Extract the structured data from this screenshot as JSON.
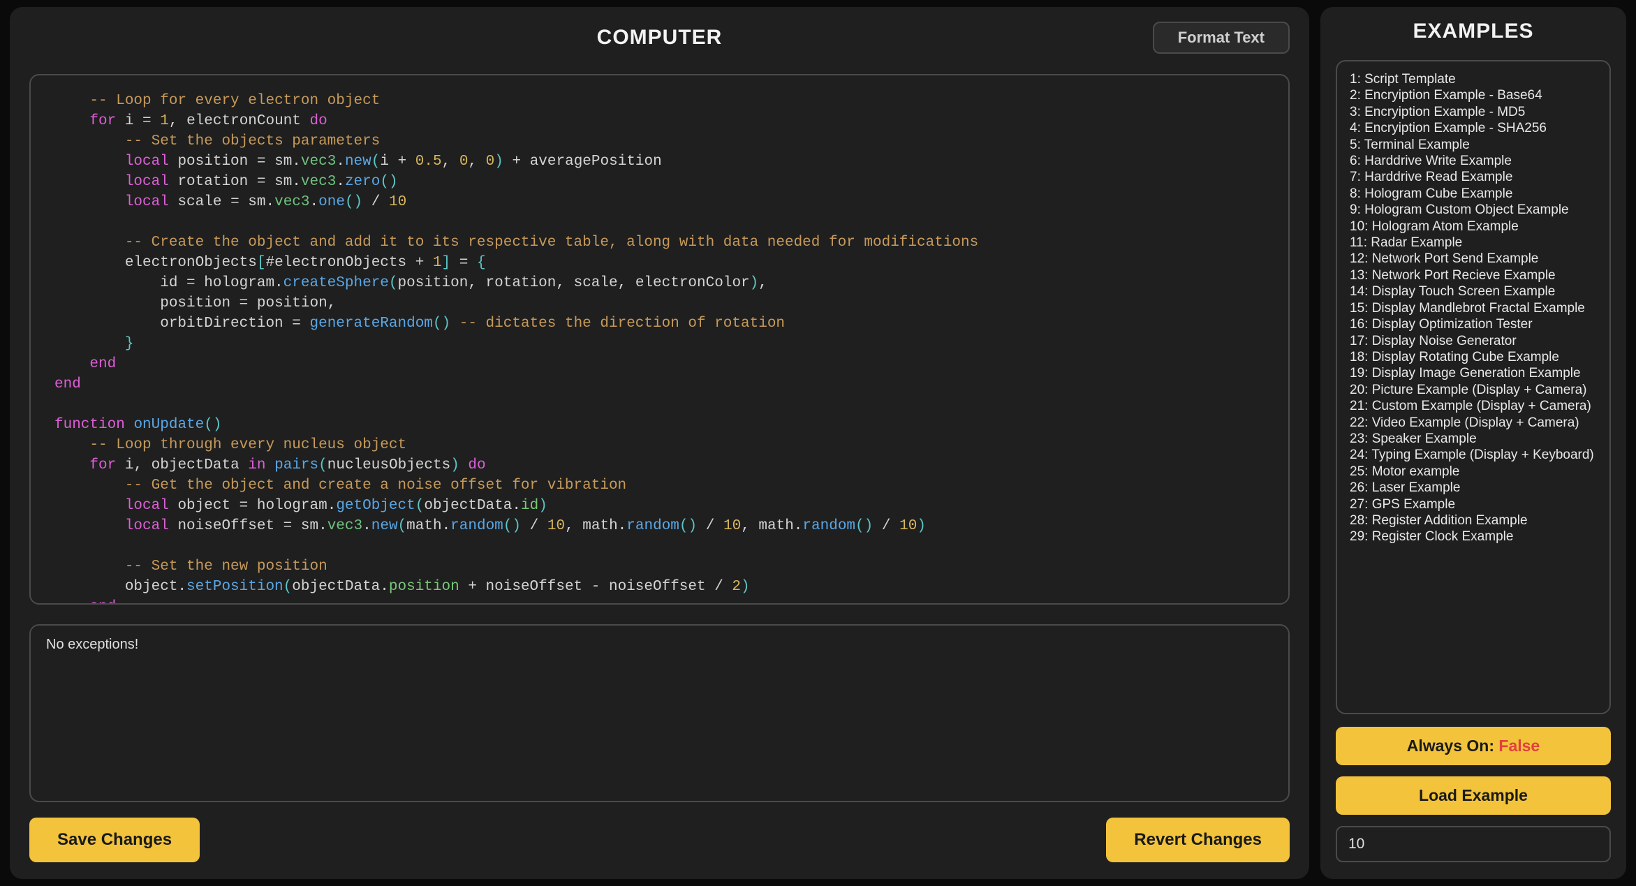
{
  "header": {
    "title": "COMPUTER",
    "format_button": "Format Text"
  },
  "console": {
    "message": "No exceptions!"
  },
  "buttons": {
    "save": "Save Changes",
    "revert": "Revert Changes"
  },
  "side": {
    "title": "EXAMPLES",
    "always_on_label": "Always On: ",
    "always_on_value": "False",
    "load_label": "Load Example",
    "input_value": "10",
    "examples": [
      "1: Script Template",
      "2: Encryiption Example - Base64",
      "3: Encryiption Example - MD5",
      "4: Encryiption Example - SHA256",
      "5: Terminal Example",
      "6: Harddrive Write Example",
      "7: Harddrive Read Example",
      "8: Hologram Cube Example",
      "9: Hologram Custom Object Example",
      "10: Hologram Atom Example",
      "11: Radar Example",
      "12: Network Port Send Example",
      "13: Network Port Recieve Example",
      "14: Display Touch Screen Example",
      "15: Display Mandlebrot Fractal Example",
      "16: Display Optimization Tester",
      "17: Display Noise Generator",
      "18: Display Rotating Cube Example",
      "19: Display Image Generation Example",
      "20: Picture Example (Display + Camera)",
      "21: Custom Example (Display + Camera)",
      "22: Video Example (Display + Camera)",
      "23: Speaker Example",
      "24: Typing Example (Display + Keyboard)",
      "25: Motor example",
      "26: Laser Example",
      "27: GPS Example",
      "28: Register Addition Example",
      "29: Register Clock Example"
    ]
  },
  "code": {
    "tokens": [
      {
        "t": "plain",
        "v": "    "
      },
      {
        "t": "comment",
        "v": "-- Loop for every electron object"
      },
      {
        "t": "nl"
      },
      {
        "t": "plain",
        "v": "    "
      },
      {
        "t": "kw",
        "v": "for"
      },
      {
        "t": "plain",
        "v": " i "
      },
      {
        "t": "op",
        "v": "="
      },
      {
        "t": "plain",
        "v": " "
      },
      {
        "t": "num",
        "v": "1"
      },
      {
        "t": "op",
        "v": ","
      },
      {
        "t": "plain",
        "v": " electronCount "
      },
      {
        "t": "kw",
        "v": "do"
      },
      {
        "t": "nl"
      },
      {
        "t": "plain",
        "v": "        "
      },
      {
        "t": "comment",
        "v": "-- Set the objects parameters"
      },
      {
        "t": "nl"
      },
      {
        "t": "plain",
        "v": "        "
      },
      {
        "t": "kw",
        "v": "local"
      },
      {
        "t": "plain",
        "v": " position "
      },
      {
        "t": "op",
        "v": "="
      },
      {
        "t": "plain",
        "v": " sm."
      },
      {
        "t": "type",
        "v": "vec3"
      },
      {
        "t": "op",
        "v": "."
      },
      {
        "t": "func",
        "v": "new"
      },
      {
        "t": "paren",
        "v": "("
      },
      {
        "t": "plain",
        "v": "i "
      },
      {
        "t": "op",
        "v": "+"
      },
      {
        "t": "plain",
        "v": " "
      },
      {
        "t": "num",
        "v": "0.5"
      },
      {
        "t": "op",
        "v": ","
      },
      {
        "t": "plain",
        "v": " "
      },
      {
        "t": "num",
        "v": "0"
      },
      {
        "t": "op",
        "v": ","
      },
      {
        "t": "plain",
        "v": " "
      },
      {
        "t": "num",
        "v": "0"
      },
      {
        "t": "paren",
        "v": ")"
      },
      {
        "t": "plain",
        "v": " "
      },
      {
        "t": "op",
        "v": "+"
      },
      {
        "t": "plain",
        "v": " averagePosition"
      },
      {
        "t": "nl"
      },
      {
        "t": "plain",
        "v": "        "
      },
      {
        "t": "kw",
        "v": "local"
      },
      {
        "t": "plain",
        "v": " rotation "
      },
      {
        "t": "op",
        "v": "="
      },
      {
        "t": "plain",
        "v": " sm."
      },
      {
        "t": "type",
        "v": "vec3"
      },
      {
        "t": "op",
        "v": "."
      },
      {
        "t": "func",
        "v": "zero"
      },
      {
        "t": "paren",
        "v": "()"
      },
      {
        "t": "nl"
      },
      {
        "t": "plain",
        "v": "        "
      },
      {
        "t": "kw",
        "v": "local"
      },
      {
        "t": "plain",
        "v": " scale "
      },
      {
        "t": "op",
        "v": "="
      },
      {
        "t": "plain",
        "v": " sm."
      },
      {
        "t": "type",
        "v": "vec3"
      },
      {
        "t": "op",
        "v": "."
      },
      {
        "t": "func",
        "v": "one"
      },
      {
        "t": "paren",
        "v": "()"
      },
      {
        "t": "plain",
        "v": " "
      },
      {
        "t": "op",
        "v": "/"
      },
      {
        "t": "plain",
        "v": " "
      },
      {
        "t": "num",
        "v": "10"
      },
      {
        "t": "nl"
      },
      {
        "t": "nl"
      },
      {
        "t": "plain",
        "v": "        "
      },
      {
        "t": "comment",
        "v": "-- Create the object and add it to its respective table, along with data needed for modifications"
      },
      {
        "t": "nl"
      },
      {
        "t": "plain",
        "v": "        electronObjects"
      },
      {
        "t": "paren",
        "v": "["
      },
      {
        "t": "op",
        "v": "#"
      },
      {
        "t": "plain",
        "v": "electronObjects "
      },
      {
        "t": "op",
        "v": "+"
      },
      {
        "t": "plain",
        "v": " "
      },
      {
        "t": "num",
        "v": "1"
      },
      {
        "t": "paren",
        "v": "]"
      },
      {
        "t": "plain",
        "v": " "
      },
      {
        "t": "op",
        "v": "="
      },
      {
        "t": "plain",
        "v": " "
      },
      {
        "t": "paren",
        "v": "{"
      },
      {
        "t": "nl"
      },
      {
        "t": "plain",
        "v": "            id "
      },
      {
        "t": "op",
        "v": "="
      },
      {
        "t": "plain",
        "v": " hologram."
      },
      {
        "t": "func",
        "v": "createSphere"
      },
      {
        "t": "paren",
        "v": "("
      },
      {
        "t": "plain",
        "v": "position"
      },
      {
        "t": "op",
        "v": ","
      },
      {
        "t": "plain",
        "v": " rotation"
      },
      {
        "t": "op",
        "v": ","
      },
      {
        "t": "plain",
        "v": " scale"
      },
      {
        "t": "op",
        "v": ","
      },
      {
        "t": "plain",
        "v": " electronColor"
      },
      {
        "t": "paren",
        "v": ")"
      },
      {
        "t": "op",
        "v": ","
      },
      {
        "t": "nl"
      },
      {
        "t": "plain",
        "v": "            position "
      },
      {
        "t": "op",
        "v": "="
      },
      {
        "t": "plain",
        "v": " position"
      },
      {
        "t": "op",
        "v": ","
      },
      {
        "t": "nl"
      },
      {
        "t": "plain",
        "v": "            orbitDirection "
      },
      {
        "t": "op",
        "v": "="
      },
      {
        "t": "plain",
        "v": " "
      },
      {
        "t": "func",
        "v": "generateRandom"
      },
      {
        "t": "paren",
        "v": "()"
      },
      {
        "t": "plain",
        "v": " "
      },
      {
        "t": "comment",
        "v": "-- dictates the direction of rotation"
      },
      {
        "t": "nl"
      },
      {
        "t": "plain",
        "v": "        "
      },
      {
        "t": "paren",
        "v": "}"
      },
      {
        "t": "nl"
      },
      {
        "t": "plain",
        "v": "    "
      },
      {
        "t": "kw",
        "v": "end"
      },
      {
        "t": "nl"
      },
      {
        "t": "kw",
        "v": "end"
      },
      {
        "t": "nl"
      },
      {
        "t": "nl"
      },
      {
        "t": "kw",
        "v": "function"
      },
      {
        "t": "plain",
        "v": " "
      },
      {
        "t": "func",
        "v": "onUpdate"
      },
      {
        "t": "paren",
        "v": "()"
      },
      {
        "t": "nl"
      },
      {
        "t": "plain",
        "v": "    "
      },
      {
        "t": "comment",
        "v": "-- Loop through every nucleus object"
      },
      {
        "t": "nl"
      },
      {
        "t": "plain",
        "v": "    "
      },
      {
        "t": "kw",
        "v": "for"
      },
      {
        "t": "plain",
        "v": " i"
      },
      {
        "t": "op",
        "v": ","
      },
      {
        "t": "plain",
        "v": " objectData "
      },
      {
        "t": "kw",
        "v": "in"
      },
      {
        "t": "plain",
        "v": " "
      },
      {
        "t": "func",
        "v": "pairs"
      },
      {
        "t": "paren",
        "v": "("
      },
      {
        "t": "plain",
        "v": "nucleusObjects"
      },
      {
        "t": "paren",
        "v": ")"
      },
      {
        "t": "plain",
        "v": " "
      },
      {
        "t": "kw",
        "v": "do"
      },
      {
        "t": "nl"
      },
      {
        "t": "plain",
        "v": "        "
      },
      {
        "t": "comment",
        "v": "-- Get the object and create a noise offset for vibration"
      },
      {
        "t": "nl"
      },
      {
        "t": "plain",
        "v": "        "
      },
      {
        "t": "kw",
        "v": "local"
      },
      {
        "t": "plain",
        "v": " object "
      },
      {
        "t": "op",
        "v": "="
      },
      {
        "t": "plain",
        "v": " hologram."
      },
      {
        "t": "func",
        "v": "getObject"
      },
      {
        "t": "paren",
        "v": "("
      },
      {
        "t": "plain",
        "v": "objectData."
      },
      {
        "t": "field",
        "v": "id"
      },
      {
        "t": "paren",
        "v": ")"
      },
      {
        "t": "nl"
      },
      {
        "t": "plain",
        "v": "        "
      },
      {
        "t": "kw",
        "v": "local"
      },
      {
        "t": "plain",
        "v": " noiseOffset "
      },
      {
        "t": "op",
        "v": "="
      },
      {
        "t": "plain",
        "v": " sm."
      },
      {
        "t": "type",
        "v": "vec3"
      },
      {
        "t": "op",
        "v": "."
      },
      {
        "t": "func",
        "v": "new"
      },
      {
        "t": "paren",
        "v": "("
      },
      {
        "t": "plain",
        "v": "math."
      },
      {
        "t": "func",
        "v": "random"
      },
      {
        "t": "paren",
        "v": "()"
      },
      {
        "t": "plain",
        "v": " "
      },
      {
        "t": "op",
        "v": "/"
      },
      {
        "t": "plain",
        "v": " "
      },
      {
        "t": "num",
        "v": "10"
      },
      {
        "t": "op",
        "v": ","
      },
      {
        "t": "plain",
        "v": " math."
      },
      {
        "t": "func",
        "v": "random"
      },
      {
        "t": "paren",
        "v": "()"
      },
      {
        "t": "plain",
        "v": " "
      },
      {
        "t": "op",
        "v": "/"
      },
      {
        "t": "plain",
        "v": " "
      },
      {
        "t": "num",
        "v": "10"
      },
      {
        "t": "op",
        "v": ","
      },
      {
        "t": "plain",
        "v": " math."
      },
      {
        "t": "func",
        "v": "random"
      },
      {
        "t": "paren",
        "v": "()"
      },
      {
        "t": "plain",
        "v": " "
      },
      {
        "t": "op",
        "v": "/"
      },
      {
        "t": "plain",
        "v": " "
      },
      {
        "t": "num",
        "v": "10"
      },
      {
        "t": "paren",
        "v": ")"
      },
      {
        "t": "nl"
      },
      {
        "t": "nl"
      },
      {
        "t": "plain",
        "v": "        "
      },
      {
        "t": "comment",
        "v": "-- Set the new position"
      },
      {
        "t": "nl"
      },
      {
        "t": "plain",
        "v": "        object."
      },
      {
        "t": "func",
        "v": "setPosition"
      },
      {
        "t": "paren",
        "v": "("
      },
      {
        "t": "plain",
        "v": "objectData."
      },
      {
        "t": "field",
        "v": "position"
      },
      {
        "t": "plain",
        "v": " "
      },
      {
        "t": "op",
        "v": "+"
      },
      {
        "t": "plain",
        "v": " noiseOffset "
      },
      {
        "t": "op",
        "v": "-"
      },
      {
        "t": "plain",
        "v": " noiseOffset "
      },
      {
        "t": "op",
        "v": "/"
      },
      {
        "t": "plain",
        "v": " "
      },
      {
        "t": "num",
        "v": "2"
      },
      {
        "t": "paren",
        "v": ")"
      },
      {
        "t": "nl"
      },
      {
        "t": "plain",
        "v": "    "
      },
      {
        "t": "kw",
        "v": "end"
      }
    ]
  }
}
